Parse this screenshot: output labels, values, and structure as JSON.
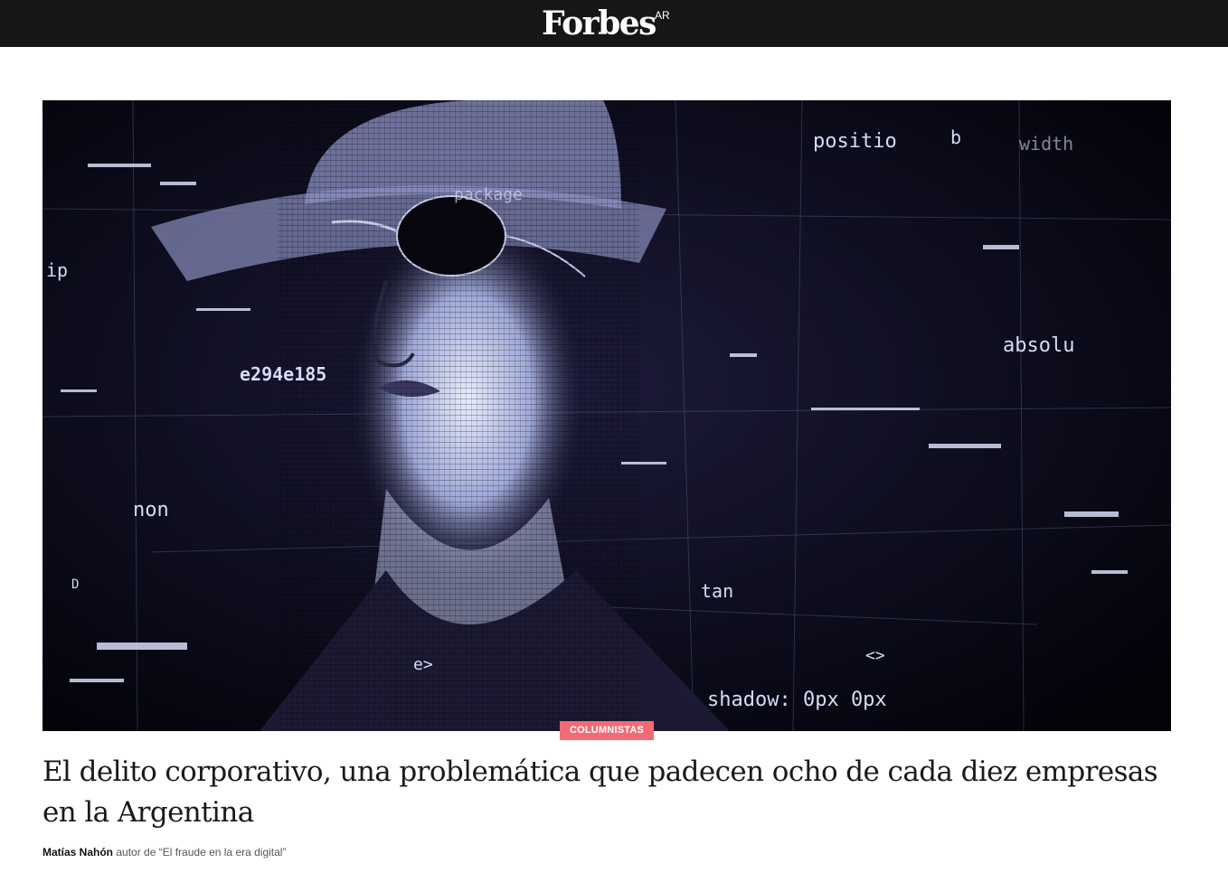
{
  "header": {
    "logo": "Forbes",
    "edition": "AR",
    "background_color": "#161616"
  },
  "hero": {
    "overlay_text": [
      "positio",
      "package",
      "e294e185",
      "non",
      "absolu",
      "shadow: 0px 0px",
      "tan",
      "<>",
      "e>",
      "D",
      "ip",
      "b",
      "width"
    ]
  },
  "article": {
    "category": "COLUMNISTAS",
    "category_color": "#f06b75",
    "title": "El delito corporativo, una problemática que padecen ocho de cada diez empresas en la Argentina",
    "author": "Matías Nahón",
    "author_bio": "autor de “El fraude en la era digital”"
  }
}
